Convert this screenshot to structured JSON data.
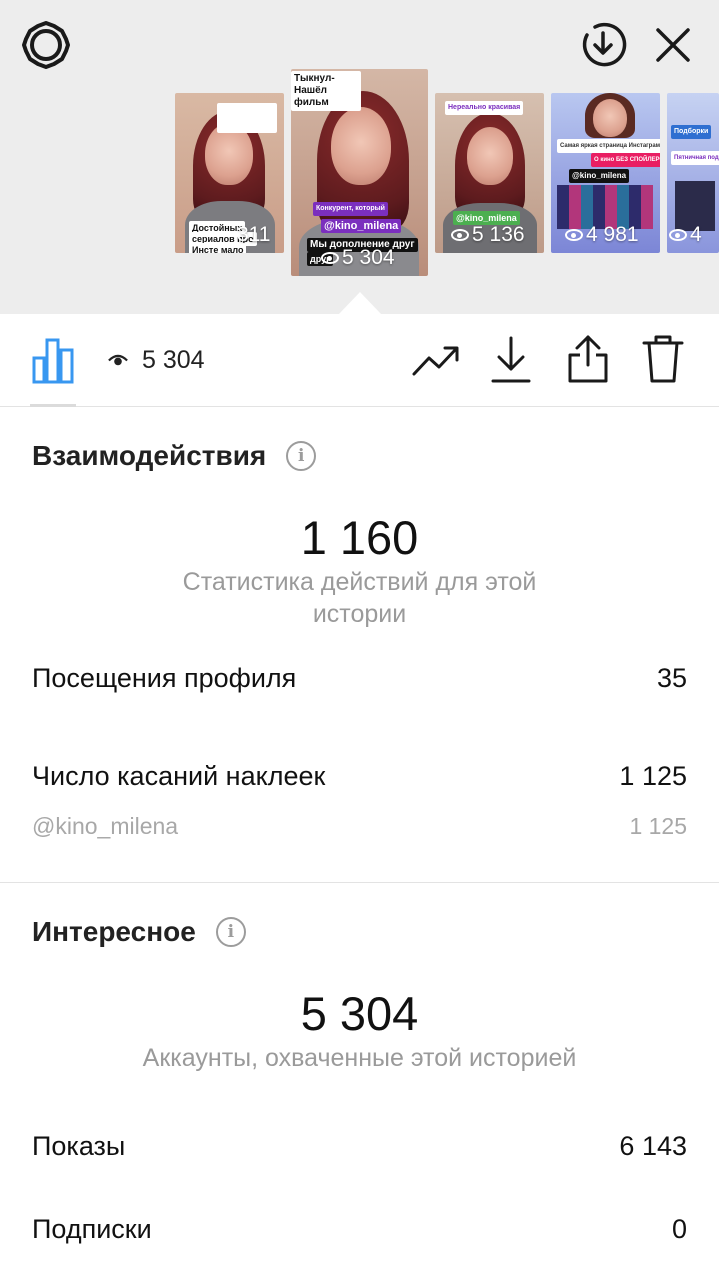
{
  "header": {
    "settings_icon": "gear-icon",
    "download_icon": "download-circle-icon",
    "close_icon": "close-icon"
  },
  "stories": [
    {
      "tags": [
        "Достойных",
        "сериалов про",
        "Инсте мало"
      ],
      "count": "311"
    },
    {
      "caption": "Тыкнул- Нашёл фильм",
      "tags": [
        "Конкурент, который",
        "@kino_milena",
        "Мы дополнение друг",
        "друг"
      ],
      "count": "5 304"
    },
    {
      "tags": [
        "Нереально красивая",
        "@kino_milena"
      ],
      "count": "5 136"
    },
    {
      "tags": [
        "Самая яркая страница Инстаграма",
        "О кино БЕЗ СПОЙЛЕРОВ!",
        "@kino_milena"
      ],
      "count": "4 981"
    },
    {
      "tags": [
        "Подборки",
        "Пятничная подборка на вечер"
      ],
      "count": "4"
    }
  ],
  "toolbar": {
    "views_value": "5 304",
    "icons": [
      "bar-chart-icon",
      "trend-icon",
      "download-icon",
      "share-icon",
      "trash-icon"
    ]
  },
  "interactions": {
    "title": "Взаимодействия",
    "total": "1 160",
    "total_label": "Статистика действий для этой истории",
    "rows": [
      {
        "label": "Посещения профиля",
        "value": "35"
      },
      {
        "label": "Число касаний наклеек",
        "value": "1 125"
      },
      {
        "label": "@kino_milena",
        "value": "1 125"
      }
    ]
  },
  "discovery": {
    "title": "Интересное",
    "total": "5 304",
    "total_label": "Аккаунты, охваченные этой историей",
    "rows": [
      {
        "label": "Показы",
        "value": "6 143"
      },
      {
        "label": "Подписки",
        "value": "0"
      }
    ]
  },
  "colors": {
    "accent": "#3897f0",
    "background_top": "#ededed",
    "muted_text": "#9a9a9a"
  }
}
